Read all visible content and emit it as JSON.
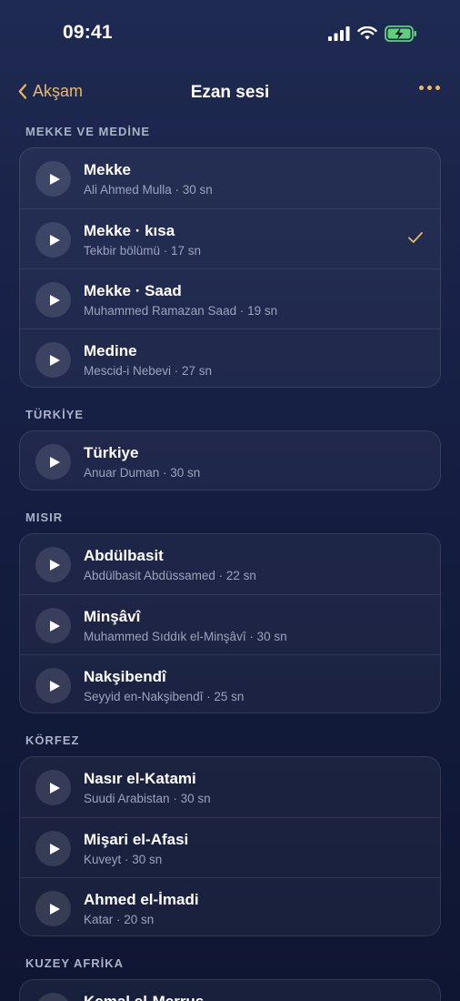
{
  "status": {
    "time": "09:41"
  },
  "nav": {
    "back_label": "Akşam",
    "title": "Ezan sesi"
  },
  "sections": [
    {
      "title": "MEKKE VE MEDİNE",
      "items": [
        {
          "title": "Mekke",
          "subtitle": "Ali Ahmed Mulla · 30 sn",
          "selected": false
        },
        {
          "title": "Mekke · kısa",
          "subtitle": "Tekbir bölümü · 17 sn",
          "selected": true
        },
        {
          "title": "Mekke · Saad",
          "subtitle": "Muhammed Ramazan Saad · 19 sn",
          "selected": false
        },
        {
          "title": "Medine",
          "subtitle": "Mescid-i Nebevi · 27 sn",
          "selected": false
        }
      ]
    },
    {
      "title": "TÜRKİYE",
      "items": [
        {
          "title": "Türkiye",
          "subtitle": "Anuar Duman · 30 sn",
          "selected": false
        }
      ]
    },
    {
      "title": "MISIR",
      "items": [
        {
          "title": "Abdülbasit",
          "subtitle": "Abdülbasit Abdüssamed · 22 sn",
          "selected": false
        },
        {
          "title": "Minşâvî",
          "subtitle": "Muhammed Sıddık el-Minşâvî · 30 sn",
          "selected": false
        },
        {
          "title": "Nakşibendî",
          "subtitle": "Seyyid en-Nakşibendî · 25 sn",
          "selected": false
        }
      ]
    },
    {
      "title": "KÖRFEZ",
      "items": [
        {
          "title": "Nasır el-Katami",
          "subtitle": "Suudi Arabistan · 30 sn",
          "selected": false
        },
        {
          "title": "Mişari el-Afasi",
          "subtitle": "Kuveyt · 30 sn",
          "selected": false
        },
        {
          "title": "Ahmed el-İmadi",
          "subtitle": "Katar · 20 sn",
          "selected": false
        }
      ]
    },
    {
      "title": "KUZEY AFRİKA",
      "items": [
        {
          "title": "Kemal el-Merrus",
          "subtitle": "",
          "selected": false
        }
      ]
    }
  ],
  "colors": {
    "accent": "#e9b965",
    "background": "#172046"
  },
  "icons": [
    "signal-icon",
    "wifi-icon",
    "battery-charging-icon",
    "chevron-left-icon",
    "more-icon",
    "play-icon",
    "checkmark-icon"
  ]
}
